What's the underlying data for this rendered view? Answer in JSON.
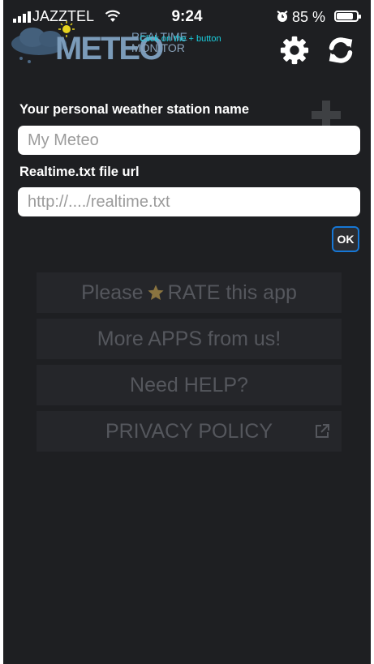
{
  "status_bar": {
    "carrier": "JAZZTEL",
    "time": "9:24",
    "battery_text": "85 %",
    "battery_level": 0.85
  },
  "header": {
    "logo_word": "METEO",
    "logo_line1": "REALTIME",
    "logo_line2": "MONITOR",
    "hint": "Click on the + button",
    "icons": [
      "gear-icon",
      "refresh-icon"
    ]
  },
  "form": {
    "station_label": "Your personal weather station name",
    "station_value": "",
    "station_placeholder": "My Meteo",
    "url_label": "Realtime.txt file url",
    "url_value": "",
    "url_placeholder": "http://..../realtime.txt",
    "ok_label": "OK"
  },
  "menu": {
    "rate_prefix": "Please",
    "rate_suffix": "RATE this app",
    "more_apps": "More APPS from us!",
    "help": "Need HELP?",
    "privacy": "PRIVACY POLICY"
  },
  "colors": {
    "background": "#1e1f22",
    "accent": "#1ad0e0",
    "ok_border": "#1677d6",
    "star": "#8a7440"
  }
}
